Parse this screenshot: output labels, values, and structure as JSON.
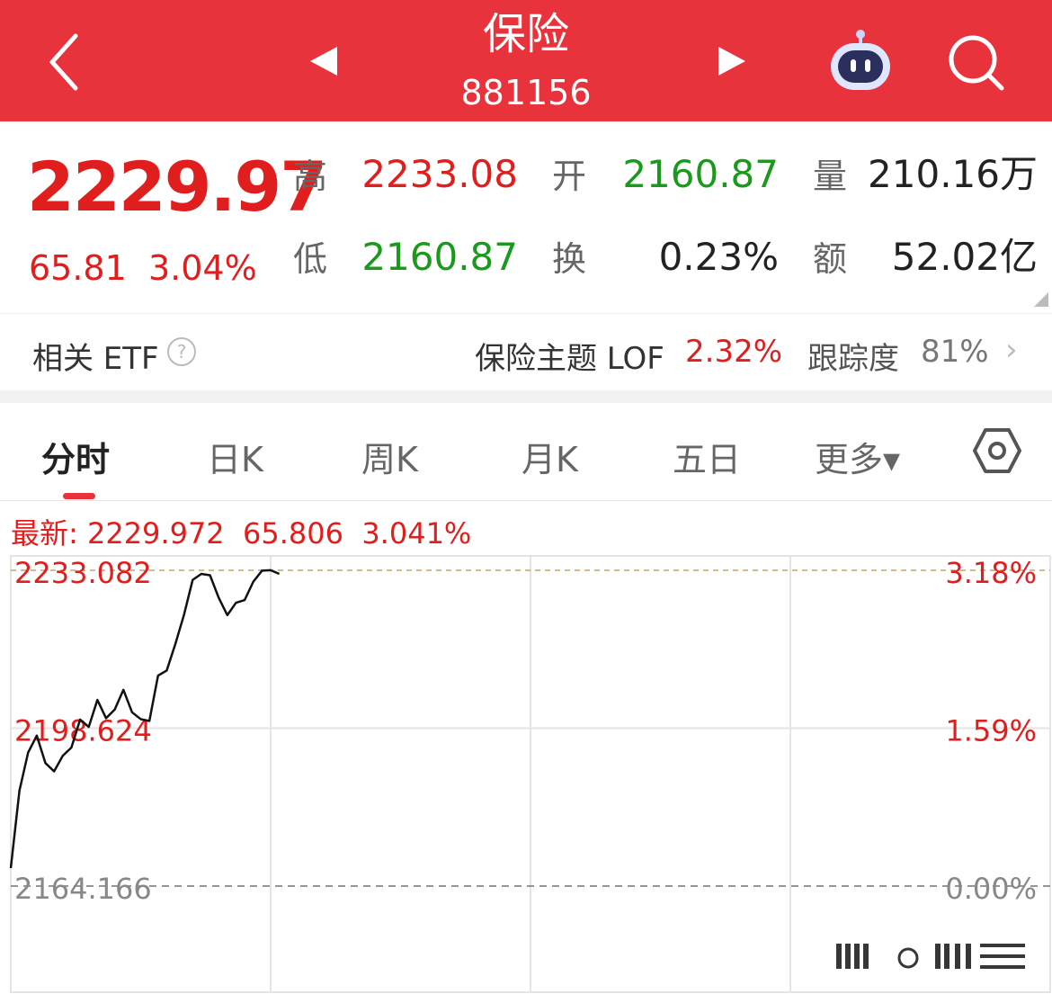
{
  "header": {
    "title": "保险",
    "code": "881156"
  },
  "quote": {
    "price": "2229.97",
    "change": "65.81",
    "change_pct": "3.04%",
    "high_label": "高",
    "high": "2233.08",
    "low_label": "低",
    "low": "2160.87",
    "open_label": "开",
    "open": "2160.87",
    "turnover_label": "换",
    "turnover": "0.23%",
    "volume_label": "量",
    "volume": "210.16万",
    "amount_label": "额",
    "amount": "52.02亿"
  },
  "etf": {
    "label": "相关 ETF",
    "help": "?",
    "name": "保险主题 LOF",
    "pct": "2.32%",
    "track_label": "跟踪度",
    "track_value": "81%"
  },
  "tabs": [
    {
      "label": "分时"
    },
    {
      "label": "日K"
    },
    {
      "label": "周K"
    },
    {
      "label": "月K"
    },
    {
      "label": "五日"
    },
    {
      "label": "更多▾"
    }
  ],
  "latest": {
    "label": "最新:",
    "price": "2229.972",
    "change": "65.806",
    "pct": "3.041%"
  },
  "chart_data": {
    "type": "line",
    "y_ticks": [
      "2233.082",
      "2198.624",
      "2164.166"
    ],
    "y_pct_ticks": [
      "3.18%",
      "1.59%",
      "0.00%"
    ],
    "ylim": [
      2164.166,
      2233.082
    ],
    "xlim": [
      0,
      240
    ],
    "grid": true,
    "x": [
      0,
      2,
      4,
      6,
      8,
      10,
      12,
      14,
      16,
      18,
      20,
      22,
      24,
      26,
      28,
      30,
      32,
      34,
      36,
      38,
      40,
      42,
      44,
      46,
      48,
      50,
      52,
      54,
      56,
      58,
      60,
      62,
      64,
      66,
      68,
      70,
      72
    ],
    "values": [
      2168.1,
      2185.0,
      2193.3,
      2197.0,
      2191.0,
      2189.2,
      2192.6,
      2194.4,
      2200.5,
      2198.9,
      2204.8,
      2200.8,
      2202.7,
      2207.0,
      2202.1,
      2200.6,
      2200.2,
      2210.1,
      2211.2,
      2217.0,
      2223.4,
      2231.0,
      2232.3,
      2232.0,
      2227.1,
      2223.3,
      2226.0,
      2226.6,
      2230.6,
      2233.0,
      2233.1,
      2232.3
    ]
  }
}
